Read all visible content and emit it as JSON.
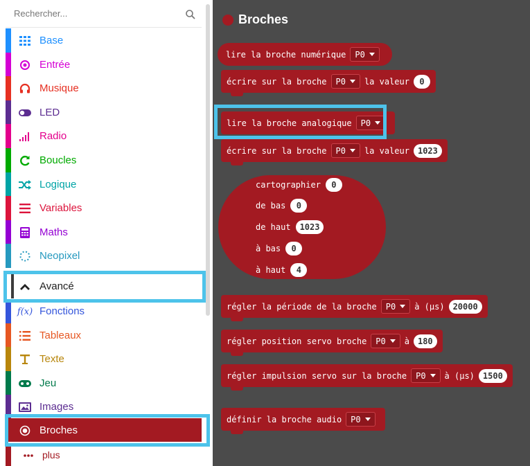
{
  "search": {
    "placeholder": "Rechercher..."
  },
  "categories": [
    {
      "label": "Base",
      "color": "#1e90ff",
      "icon": "grid-icon"
    },
    {
      "label": "Entrée",
      "color": "#d400d4",
      "icon": "target-icon"
    },
    {
      "label": "Musique",
      "color": "#e63022",
      "icon": "headphones-icon"
    },
    {
      "label": "LED",
      "color": "#5c2d91",
      "icon": "toggle-icon"
    },
    {
      "label": "Radio",
      "color": "#e3008c",
      "icon": "signal-bars-icon"
    },
    {
      "label": "Boucles",
      "color": "#00aa00",
      "icon": "refresh-icon"
    },
    {
      "label": "Logique",
      "color": "#00a4a6",
      "icon": "shuffle-icon"
    },
    {
      "label": "Variables",
      "color": "#dc143c",
      "icon": "lines-icon"
    },
    {
      "label": "Maths",
      "color": "#9400d3",
      "icon": "calculator-icon"
    },
    {
      "label": "Neopixel",
      "color": "#2699bf",
      "icon": "dotted-circle-icon"
    },
    {
      "label": "Avancé",
      "color": "#3c3c3c",
      "icon": "chevron-up-icon"
    },
    {
      "label": "Fonctions",
      "color": "#3455db",
      "icon": "function-icon"
    },
    {
      "label": "Tableaux",
      "color": "#e65722",
      "icon": "list-icon"
    },
    {
      "label": "Texte",
      "color": "#b8860b",
      "icon": "text-icon"
    },
    {
      "label": "Jeu",
      "color": "#007a4b",
      "icon": "gamepad-icon"
    },
    {
      "label": "Images",
      "color": "#5c2d91",
      "icon": "image-icon"
    },
    {
      "label": "Broches",
      "color": "#a31a22",
      "icon": "broches-icon"
    },
    {
      "label": "plus",
      "color": "#a31a22",
      "icon": "more-dots-icon"
    }
  ],
  "flyout": {
    "title": "Broches",
    "accent": "#a31a22",
    "pin": "P0",
    "blocks": {
      "digital_read": "lire la broche numérique",
      "digital_write": {
        "text": "écrire sur la broche",
        "value_label": "la valeur",
        "value": "0"
      },
      "analog_read": "lire la broche analogique",
      "analog_write": {
        "text": "écrire sur la broche",
        "value_label": "la valeur",
        "value": "1023"
      },
      "map": {
        "title": "cartographier",
        "title_value": "0",
        "from_low": "de bas",
        "from_low_value": "0",
        "from_high": "de haut",
        "from_high_value": "1023",
        "to_low": "à bas",
        "to_low_value": "0",
        "to_high": "à haut",
        "to_high_value": "4"
      },
      "analog_period": {
        "text": "régler la période de la broche",
        "unit": "à (µs)",
        "value": "20000"
      },
      "servo_write": {
        "text": "régler position servo broche",
        "unit": "à",
        "value": "180"
      },
      "servo_pulse": {
        "text": "régler impulsion servo sur la broche",
        "unit": "à (µs)",
        "value": "1500"
      },
      "audio_pin": {
        "text": "définir la broche audio"
      }
    }
  }
}
